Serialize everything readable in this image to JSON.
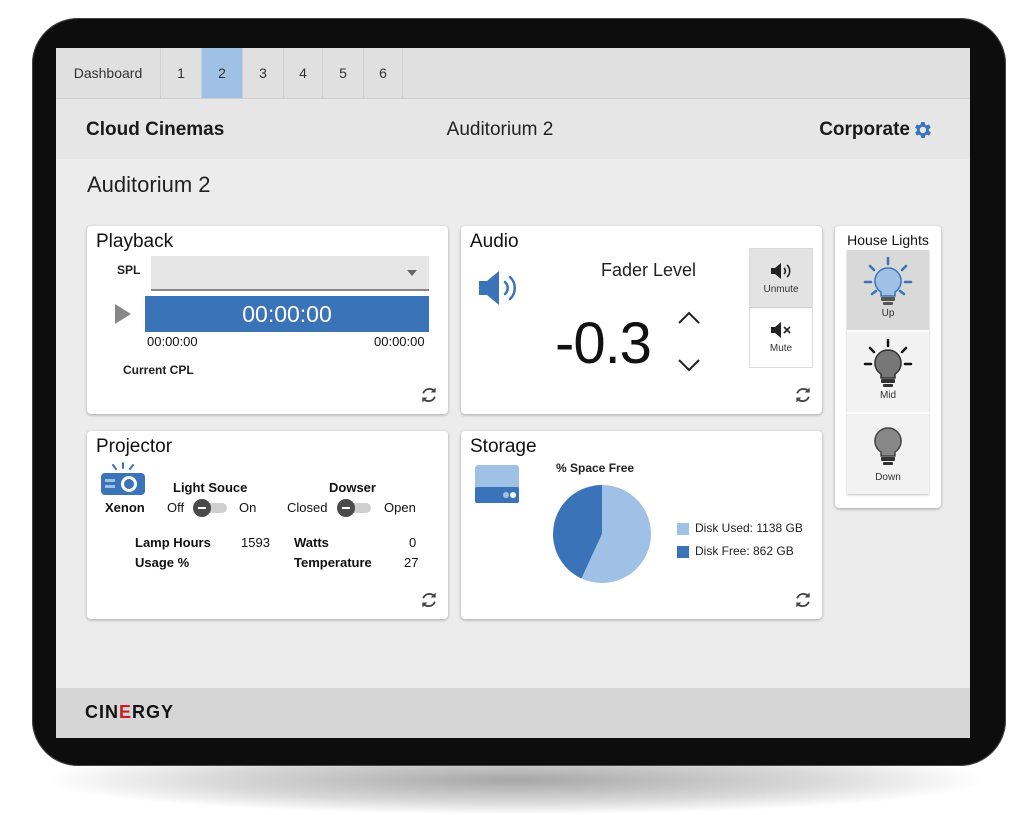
{
  "tabs": [
    {
      "label": "Dashboard",
      "active": false
    },
    {
      "label": "1",
      "active": false
    },
    {
      "label": "2",
      "active": true
    },
    {
      "label": "3",
      "active": false
    },
    {
      "label": "4",
      "active": false
    },
    {
      "label": "5",
      "active": false
    },
    {
      "label": "6",
      "active": false
    }
  ],
  "header": {
    "brand": "Cloud Cinemas",
    "title": "Auditorium 2",
    "account": "Corporate",
    "settings_icon": "gear-icon"
  },
  "page": {
    "title": "Auditorium 2"
  },
  "playback": {
    "title": "Playback",
    "spl_label": "SPL",
    "spl_value": "",
    "timecode": "00:00:00",
    "elapsed": "00:00:00",
    "total": "00:00:00",
    "current_cpl_label": "Current CPL",
    "current_cpl_value": ""
  },
  "audio": {
    "title": "Audio",
    "fader_label": "Fader Level",
    "fader_value": "-0.3",
    "unmute_label": "Unmute",
    "mute_label": "Mute"
  },
  "house_lights": {
    "title": "House Lights",
    "buttons": [
      {
        "label": "Up",
        "active": true
      },
      {
        "label": "Mid",
        "active": false
      },
      {
        "label": "Down",
        "active": false
      }
    ]
  },
  "projector": {
    "title": "Projector",
    "lamp_type": "Xenon",
    "light_source_label": "Light Souce",
    "light_off": "Off",
    "light_on": "On",
    "dowser_label": "Dowser",
    "dowser_closed": "Closed",
    "dowser_open": "Open",
    "lamp_hours_label": "Lamp Hours",
    "lamp_hours_value": "1593",
    "usage_label": "Usage %",
    "usage_value": "",
    "watts_label": "Watts",
    "watts_value": "0",
    "temperature_label": "Temperature",
    "temperature_value": "27"
  },
  "storage": {
    "title": "Storage",
    "chart_title": "% Space Free",
    "used_label": "Disk Used: 1138 GB",
    "free_label": "Disk Free: 862 GB"
  },
  "chart_data": {
    "type": "pie",
    "title": "% Space Free",
    "categories": [
      "Disk Used",
      "Disk Free"
    ],
    "values": [
      1138,
      862
    ],
    "units": "GB",
    "colors": [
      "#9fc1e6",
      "#3b73b9"
    ],
    "legend": "right"
  },
  "colors": {
    "accent": "#3b73b9",
    "accent_light": "#9fc1e6",
    "brand_red": "#c41e2a"
  },
  "footer": {
    "logo_left": "CIN",
    "logo_mid": "E",
    "logo_right": "RGY"
  }
}
